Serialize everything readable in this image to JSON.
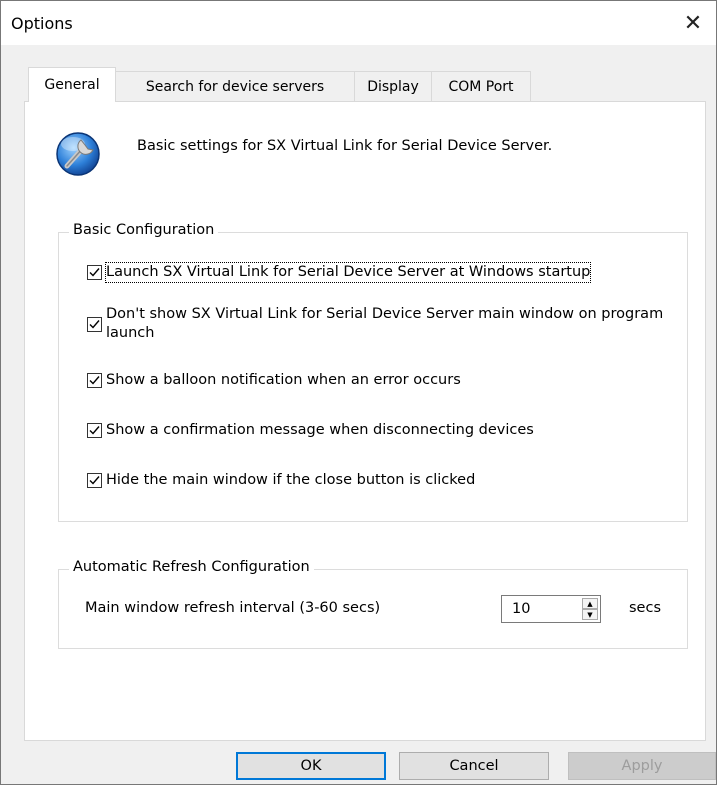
{
  "window": {
    "title": "Options"
  },
  "tabs": [
    {
      "label": "General",
      "active": true
    },
    {
      "label": "Search for device servers",
      "active": false
    },
    {
      "label": "Display",
      "active": false
    },
    {
      "label": "COM Port",
      "active": false
    }
  ],
  "header": {
    "icon": "settings-wrench-icon",
    "description": "Basic settings for SX Virtual Link for Serial Device Server."
  },
  "basic_config": {
    "title": "Basic Configuration",
    "options": [
      {
        "label": "Launch SX Virtual Link for Serial Device Server at Windows startup",
        "checked": true
      },
      {
        "label": "Don't show SX Virtual Link for Serial Device Server main window on program launch",
        "checked": true
      },
      {
        "label": "Show a balloon notification when an error occurs",
        "checked": true
      },
      {
        "label": "Show a confirmation message when disconnecting devices",
        "checked": true
      },
      {
        "label": "Hide the main window if the close button is clicked",
        "checked": true
      }
    ]
  },
  "auto_refresh": {
    "title": "Automatic Refresh Configuration",
    "interval_label": "Main window refresh interval (3-60 secs)",
    "interval_value": "10",
    "unit": "secs"
  },
  "buttons": {
    "ok": "OK",
    "cancel": "Cancel",
    "apply": "Apply"
  },
  "colors": {
    "accent": "#0078d7",
    "background": "#f0f0f0",
    "panel": "#ffffff"
  }
}
